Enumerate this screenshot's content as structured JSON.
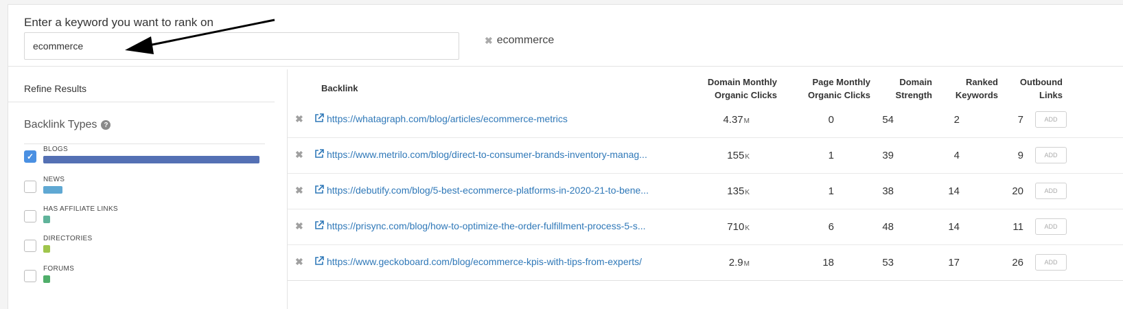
{
  "search": {
    "label": "Enter a keyword you want to rank on",
    "value": "ecommerce",
    "chip": "ecommerce"
  },
  "sidebar": {
    "refine_title": "Refine Results",
    "types_title": "Backlink Types",
    "types": [
      {
        "label": "BLOGS",
        "checked": true,
        "color": "#5470b4",
        "fraction": 1.0
      },
      {
        "label": "NEWS",
        "checked": false,
        "color": "#5fa8d3",
        "fraction": 0.09
      },
      {
        "label": "HAS AFFILIATE LINKS",
        "checked": false,
        "color": "#5fb39a",
        "fraction": 0.03
      },
      {
        "label": "DIRECTORIES",
        "checked": false,
        "color": "#9fc54c",
        "fraction": 0.03
      },
      {
        "label": "FORUMS",
        "checked": false,
        "color": "#4fae6a",
        "fraction": 0.03
      }
    ]
  },
  "table": {
    "headers": {
      "backlink": "Backlink",
      "domain_monthly_1": "Domain Monthly",
      "domain_monthly_2": "Organic Clicks",
      "page_monthly_1": "Page Monthly",
      "page_monthly_2": "Organic Clicks",
      "domain_strength_1": "Domain",
      "domain_strength_2": "Strength",
      "ranked_1": "Ranked",
      "ranked_2": "Keywords",
      "outbound_1": "Outbound",
      "outbound_2": "Links"
    },
    "add_label": "ADD",
    "rows": [
      {
        "url": "https://whatagraph.com/blog/articles/ecommerce-metrics",
        "dmoc": "4.37",
        "dmoc_unit": "M",
        "pmoc": "0",
        "ds": "54",
        "rk": "2",
        "ol": "7"
      },
      {
        "url": "https://www.metrilo.com/blog/direct-to-consumer-brands-inventory-manag...",
        "dmoc": "155",
        "dmoc_unit": "K",
        "pmoc": "1",
        "ds": "39",
        "rk": "4",
        "ol": "9"
      },
      {
        "url": "https://debutify.com/blog/5-best-ecommerce-platforms-in-2020-21-to-bene...",
        "dmoc": "135",
        "dmoc_unit": "K",
        "pmoc": "1",
        "ds": "38",
        "rk": "14",
        "ol": "20"
      },
      {
        "url": "https://prisync.com/blog/how-to-optimize-the-order-fulfillment-process-5-s...",
        "dmoc": "710",
        "dmoc_unit": "K",
        "pmoc": "6",
        "ds": "48",
        "rk": "14",
        "ol": "11"
      },
      {
        "url": "https://www.geckoboard.com/blog/ecommerce-kpis-with-tips-from-experts/",
        "dmoc": "2.9",
        "dmoc_unit": "M",
        "pmoc": "18",
        "ds": "53",
        "rk": "17",
        "ol": "26"
      }
    ]
  }
}
